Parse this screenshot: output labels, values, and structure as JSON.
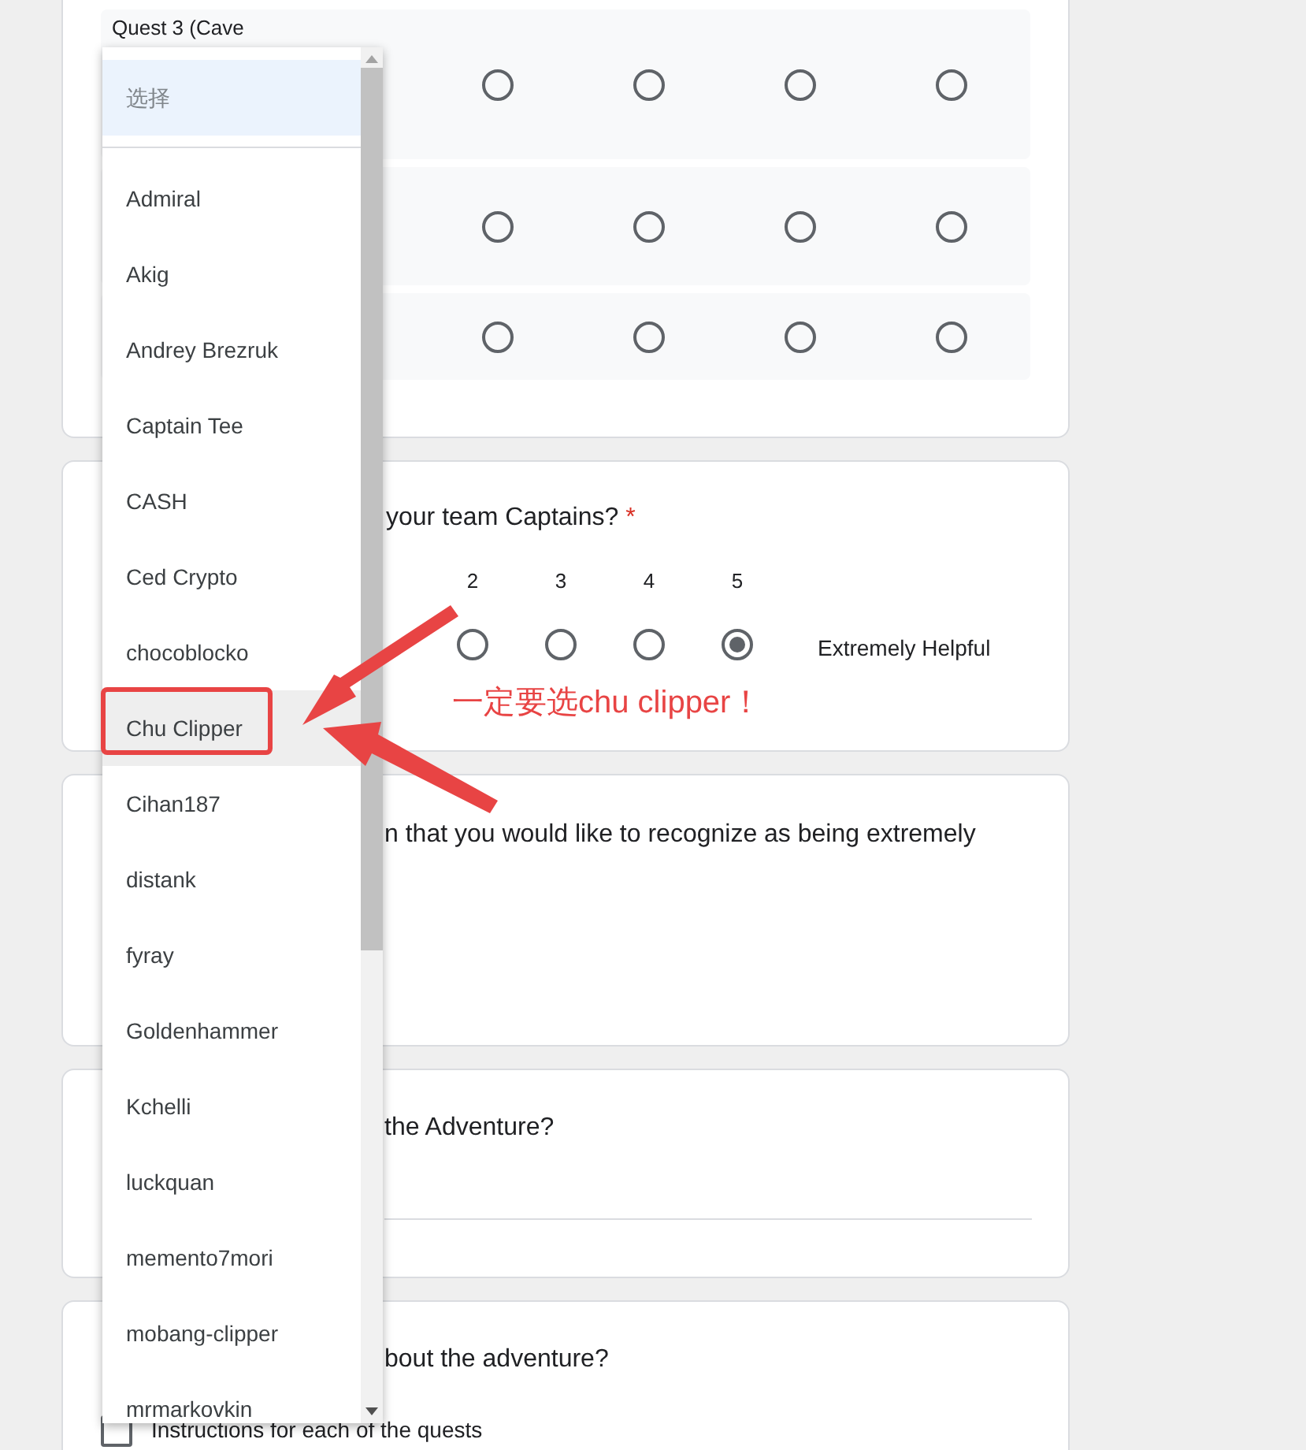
{
  "grid_question": {
    "title": "Quest 3 (Cave",
    "rows": [
      {
        "choices": [
          {
            "selected": false
          },
          {
            "selected": false
          },
          {
            "selected": false
          },
          {
            "selected": false
          }
        ]
      },
      {
        "choices": [
          {
            "selected": false
          },
          {
            "selected": false
          },
          {
            "selected": false
          },
          {
            "selected": false
          }
        ]
      },
      {
        "choices": [
          {
            "selected": false
          },
          {
            "selected": false
          },
          {
            "selected": false
          },
          {
            "selected": false
          }
        ]
      }
    ]
  },
  "scale_question": {
    "title": "your team Captains?",
    "required_mark": "*",
    "scale": [
      {
        "label": "2",
        "selected": false
      },
      {
        "label": "3",
        "selected": false
      },
      {
        "label": "4",
        "selected": false
      },
      {
        "label": "5",
        "selected": true
      }
    ],
    "high_label": "Extremely Helpful"
  },
  "recognize_question": {
    "title": "n that you would like to recognize as being extremely"
  },
  "adventure_question": {
    "title": "the Adventure?"
  },
  "about_question": {
    "title": "bout the adventure?",
    "options": [
      {
        "label": "Instructions for each of the quests",
        "checked": false
      }
    ]
  },
  "dropdown": {
    "placeholder": "选择",
    "placeholder_selected": true,
    "options": [
      {
        "label": "Admiral",
        "highlighted": false
      },
      {
        "label": "Akig",
        "highlighted": false
      },
      {
        "label": "Andrey Brezruk",
        "highlighted": false
      },
      {
        "label": "Captain Tee",
        "highlighted": false
      },
      {
        "label": "CASH",
        "highlighted": false
      },
      {
        "label": "Ced Crypto",
        "highlighted": false
      },
      {
        "label": "chocoblocko",
        "highlighted": false
      },
      {
        "label": "Chu Clipper",
        "highlighted": true
      },
      {
        "label": "Cihan187",
        "highlighted": false
      },
      {
        "label": "distank",
        "highlighted": false
      },
      {
        "label": "fyray",
        "highlighted": false
      },
      {
        "label": "Goldenhammer",
        "highlighted": false
      },
      {
        "label": "Kchelli",
        "highlighted": false
      },
      {
        "label": "luckquan",
        "highlighted": false
      },
      {
        "label": "memento7mori",
        "highlighted": false
      },
      {
        "label": "mobang-clipper",
        "highlighted": false
      },
      {
        "label": "mrmarkovkin",
        "highlighted": false
      }
    ]
  },
  "annotation": {
    "text": "一定要选chu clipper！"
  }
}
